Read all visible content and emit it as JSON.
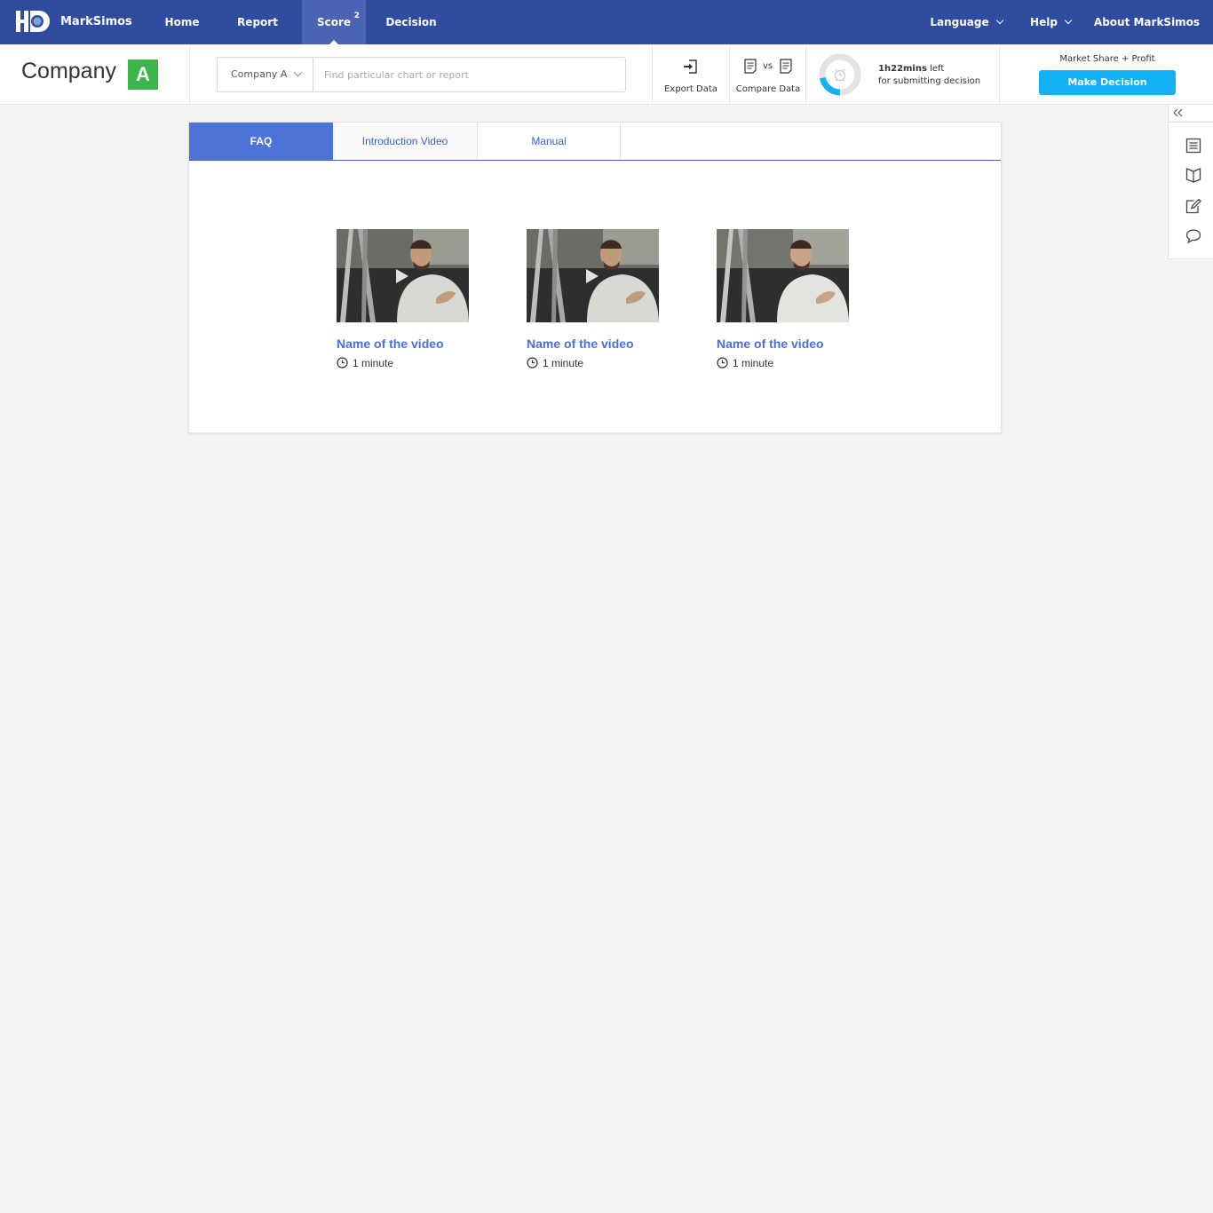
{
  "app": {
    "brand": "MarkSimos",
    "nav": [
      {
        "label": "Home"
      },
      {
        "label": "Report"
      },
      {
        "label": "Score",
        "badge": "2",
        "active": true
      },
      {
        "label": "Decision"
      }
    ],
    "right_nav": {
      "language": "Language",
      "help": "Help",
      "about": "About MarkSimos"
    }
  },
  "header": {
    "company_label": "Company",
    "company_badge": "A",
    "search": {
      "selected_company": "Company A",
      "placeholder": "Find particular chart or report",
      "value": ""
    },
    "tools": {
      "export_label": "Export Data",
      "compare_label": "Compare Data",
      "compare_vs": "vs"
    },
    "timer": {
      "remaining": "1h22mins",
      "suffix": "left",
      "line2": "for submitting decision",
      "progress_fraction": 0.22
    },
    "mode_label": "Market Share + Profit",
    "decision_button": "Make Decision"
  },
  "sidebar_icons": [
    "collapse-icon",
    "list-icon",
    "book-icon",
    "edit-icon",
    "chat-icon"
  ],
  "main": {
    "tabs": [
      {
        "label": "FAQ",
        "active": true
      },
      {
        "label": "Introduction Video"
      },
      {
        "label": "Manual"
      }
    ],
    "videos": [
      {
        "title": "Name of the video",
        "duration": "1 minute",
        "has_play_icon": true
      },
      {
        "title": "Name of the video",
        "duration": "1 minute",
        "has_play_icon": true
      },
      {
        "title": "Name of the video",
        "duration": "1 minute",
        "has_play_icon": false
      }
    ]
  },
  "colors": {
    "nav_bg": "#2f4c9e",
    "nav_active": "#4a64b3",
    "company_badge": "#3bb54a",
    "decision_button": "#11b1f3",
    "tab_active": "#4e72d8",
    "link_blue": "#4c6fd4"
  }
}
